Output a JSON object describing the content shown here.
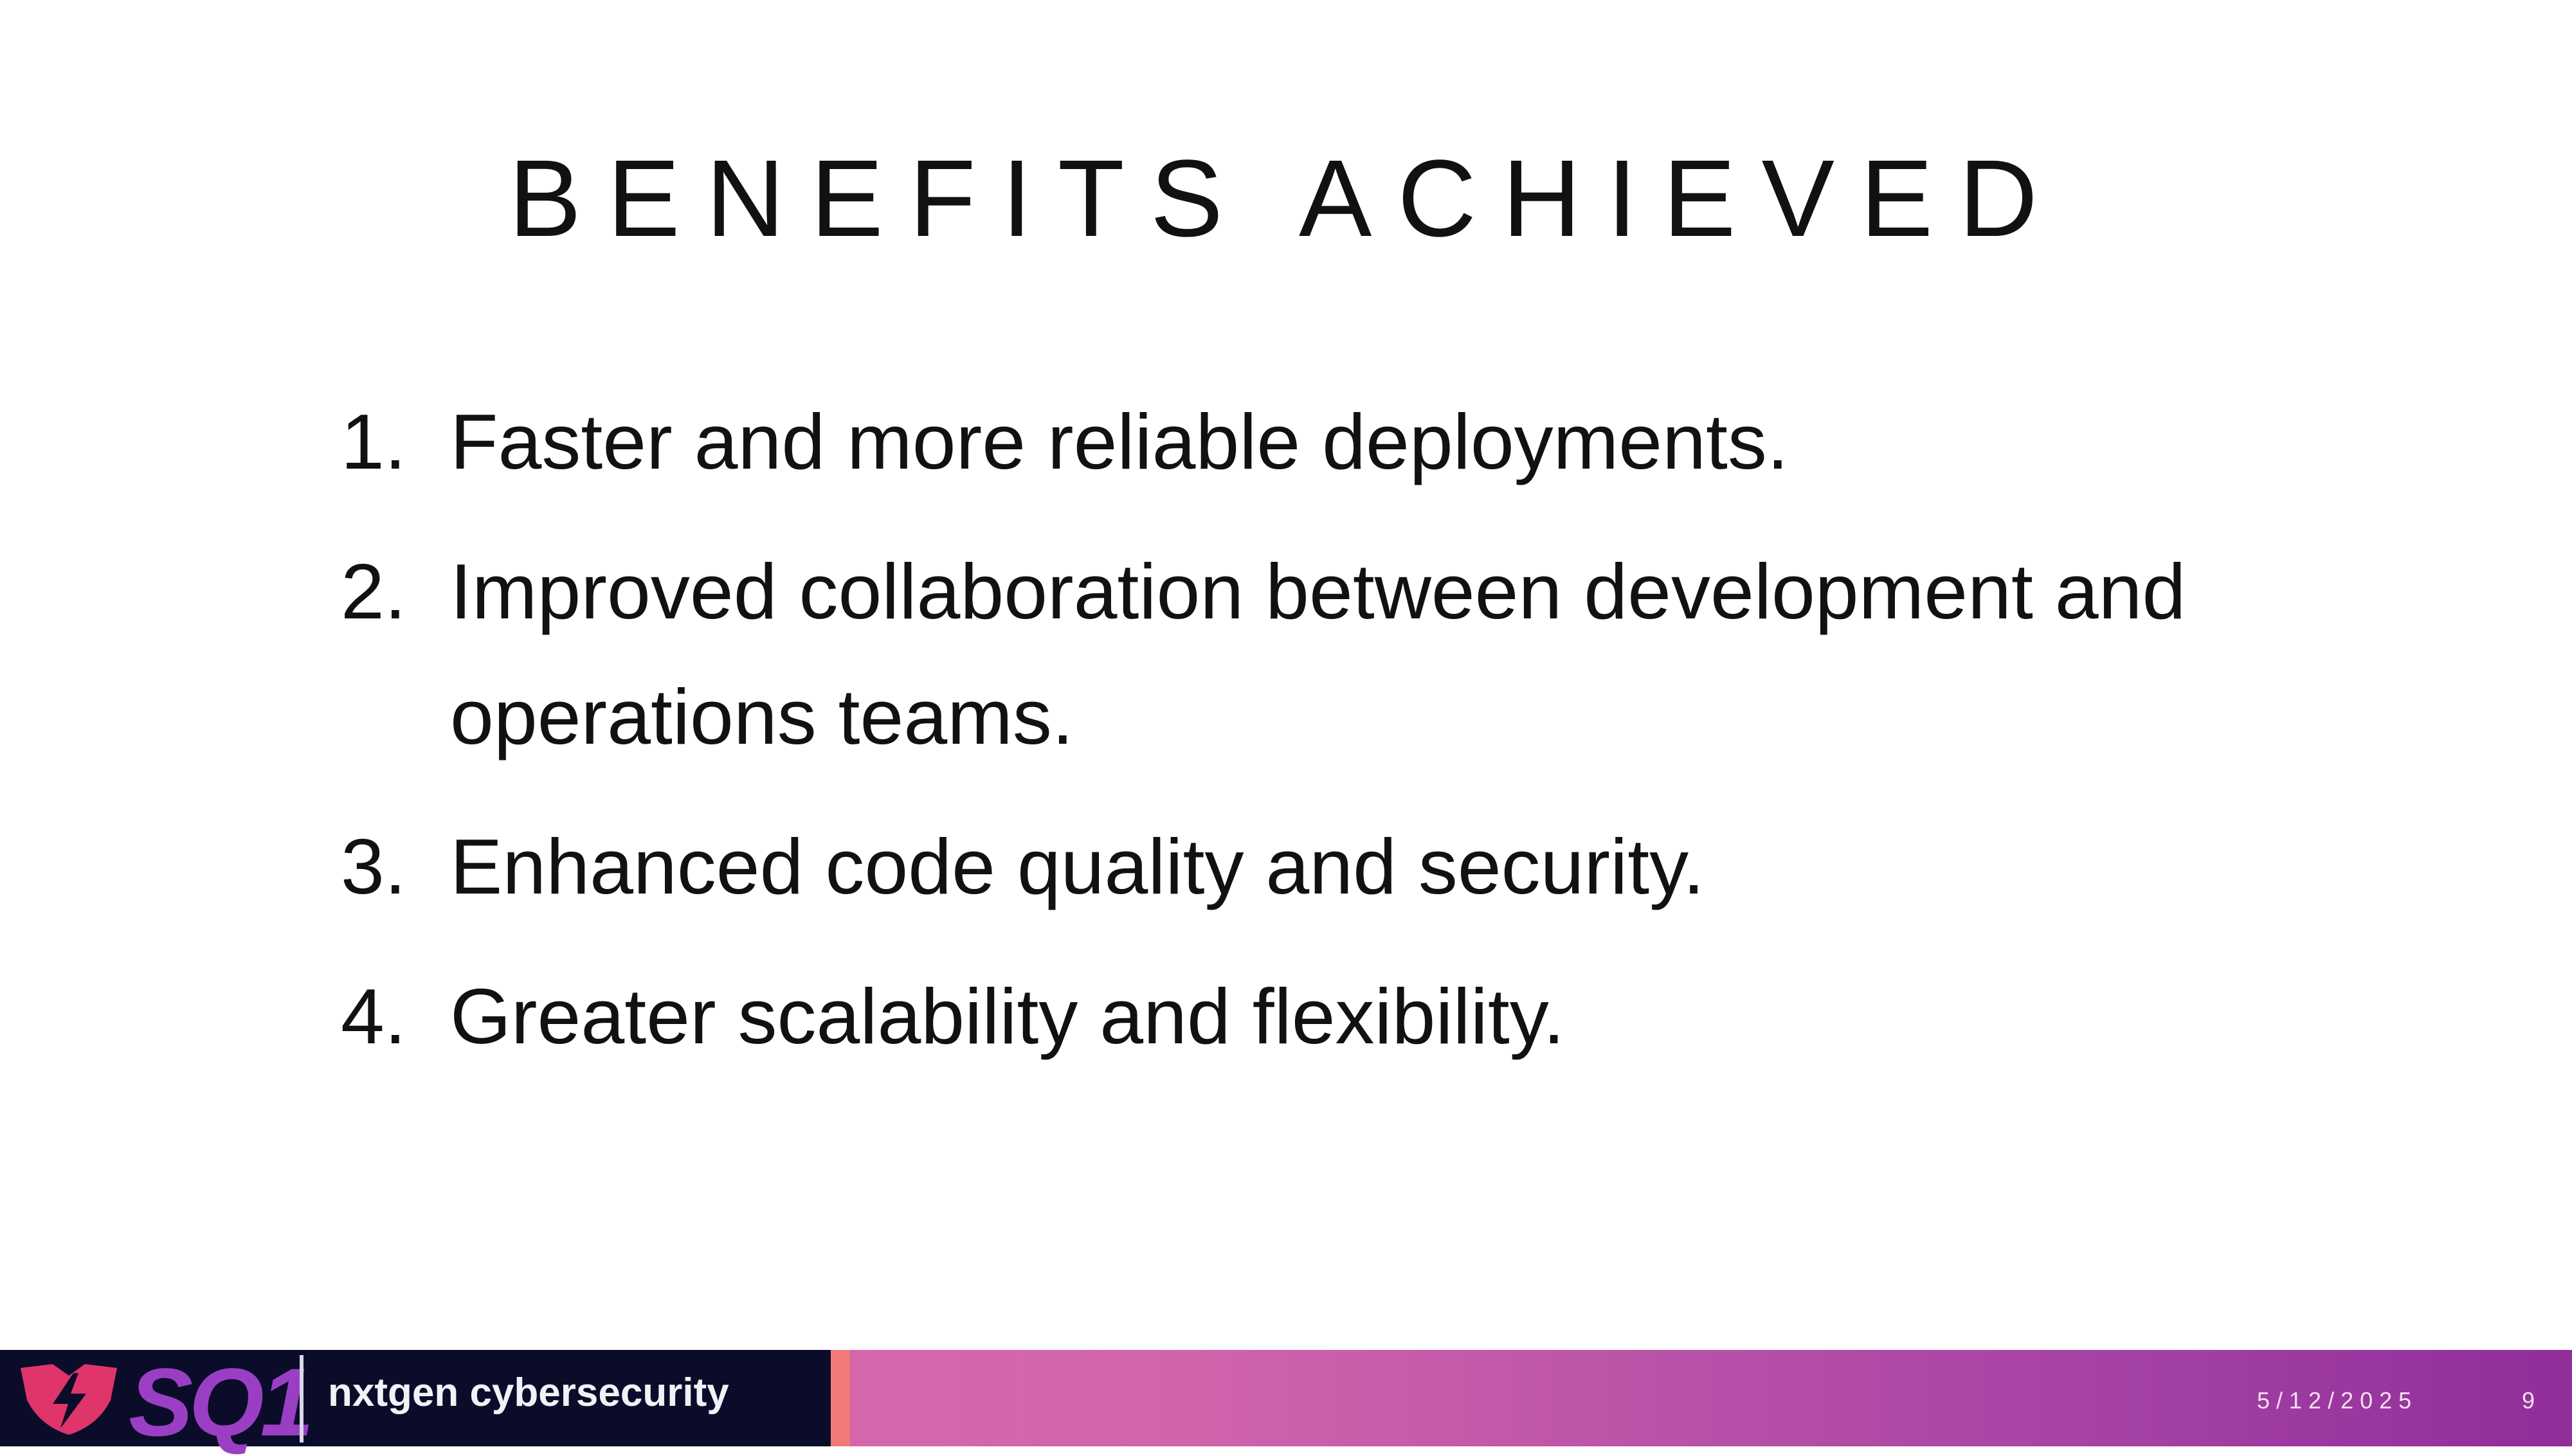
{
  "slide": {
    "title": "BENEFITS ACHIEVED",
    "items": [
      {
        "number": "1.",
        "text": "Faster and more reliable deployments."
      },
      {
        "number": "2.",
        "text": "Improved collaboration between development and operations teams."
      },
      {
        "number": "3.",
        "text": "Enhanced code quality and security."
      },
      {
        "number": "4.",
        "text": "Greater scalability and flexibility."
      }
    ]
  },
  "footer": {
    "logo_text": "SQ1",
    "brand_text": "nxtgen cybersecurity",
    "date": "5/12/2025",
    "page_number": "9",
    "colors": {
      "logo_background": "#0a0c2a",
      "logo_accent": "#9a3fc4",
      "shield": "#e0356a",
      "bar_start": "#e06aa8",
      "bar_end": "#902d9a"
    }
  }
}
